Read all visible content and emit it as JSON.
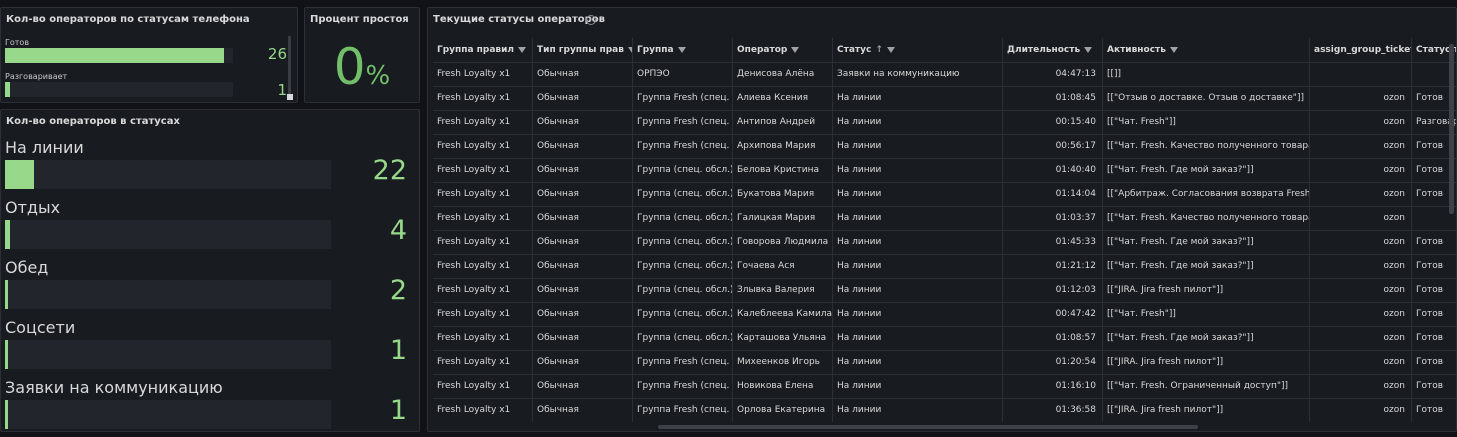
{
  "phone_panel": {
    "title": "Кол-во операторов по статусам телефона",
    "items": [
      {
        "label": "Готов",
        "value": "26",
        "fraction": 0.96
      },
      {
        "label": "Разговаривает",
        "value": "1",
        "fraction": 0.02
      }
    ]
  },
  "idle_panel": {
    "title": "Процент простоя",
    "value": "0",
    "unit": "%"
  },
  "status_panel": {
    "title": "Кол-во операторов в статусах",
    "items": [
      {
        "label": "На линии",
        "value": "22",
        "fraction": 0.088
      },
      {
        "label": "Отдых",
        "value": "4",
        "fraction": 0.016
      },
      {
        "label": "Обед",
        "value": "2",
        "fraction": 0.008
      },
      {
        "label": "Соцсети",
        "value": "1",
        "fraction": 0.004
      },
      {
        "label": "Заявки на коммуникацию",
        "value": "1",
        "fraction": 0.004
      }
    ]
  },
  "table_panel": {
    "title": "Текущие статусы операторов",
    "info_icon": "i",
    "columns": [
      "Группа правил",
      "Тип группы прав",
      "Группа",
      "Оператор",
      "Статус",
      "Длительность",
      "Активность",
      "assign_group_ticket",
      "Статус телефона"
    ],
    "sort_indicator": "↑",
    "rows": [
      [
        "Fresh Loyalty x1",
        "Обычная",
        "ОРПЭО",
        "Денисова Алёна",
        "Заявки на коммуникацию",
        "04:47:13",
        "[[]]",
        "",
        ""
      ],
      [
        "Fresh Loyalty x1",
        "Обычная",
        "Группа Fresh (спец. обсл.)",
        "Алиева Ксения",
        "На линии",
        "01:08:45",
        "[[\"Отзыв о доставке. Отзыв о доставке\"]]",
        "ozon",
        "Готов"
      ],
      [
        "Fresh Loyalty x1",
        "Обычная",
        "Группа Fresh (спец. обсл.)",
        "Антипов Андрей",
        "На линии",
        "00:15:40",
        "[[\"Чат. Fresh\"]]",
        "ozon",
        "Разговаривает"
      ],
      [
        "Fresh Loyalty x1",
        "Обычная",
        "Группа Fresh (спец. обсл.)",
        "Архипова Мария",
        "На линии",
        "00:56:17",
        "[[\"Чат. Fresh. Качество полученного товара\"]]",
        "ozon",
        "Готов"
      ],
      [
        "Fresh Loyalty x1",
        "Обычная",
        "Группа (спец. обсл.)",
        "Белова Кристина",
        "На линии",
        "01:40:40",
        "[[\"Чат. Fresh. Где мой заказ?\"]]",
        "ozon",
        "Готов"
      ],
      [
        "Fresh Loyalty x1",
        "Обычная",
        "Группа (спец. обсл.)",
        "Букатова Мария",
        "На линии",
        "01:14:04",
        "[[\"Арбитраж. Согласования возврата Fresh\"]]",
        "ozon",
        "Готов"
      ],
      [
        "Fresh Loyalty x1",
        "Обычная",
        "Группа (спец. обсл.)",
        "Галицкая Мария",
        "На линии",
        "01:03:37",
        "[[\"Чат. Fresh. Качество полученного товара\"]]",
        "ozon",
        ""
      ],
      [
        "Fresh Loyalty x1",
        "Обычная",
        "Группа (спец. обсл.)",
        "Говорова Людмила",
        "На линии",
        "01:45:33",
        "[[\"Чат. Fresh. Где мой заказ?\"]]",
        "ozon",
        "Готов"
      ],
      [
        "Fresh Loyalty x1",
        "Обычная",
        "Группа (спец. обсл.)",
        "Гочаева Ася",
        "На линии",
        "01:21:12",
        "[[\"Чат. Fresh. Где мой заказ?\"]]",
        "ozon",
        "Готов"
      ],
      [
        "Fresh Loyalty x1",
        "Обычная",
        "Группа (спец. обсл.)",
        "Злывка Валерия",
        "На линии",
        "01:12:03",
        "[[\"JIRA. Jira fresh пилот\"]]",
        "ozon",
        "Готов"
      ],
      [
        "Fresh Loyalty x1",
        "Обычная",
        "Группа (спец. обсл.)",
        "Калеблеева Камила",
        "На линии",
        "00:47:42",
        "[[\"Чат. Fresh\"]]",
        "ozon",
        "Готов"
      ],
      [
        "Fresh Loyalty x1",
        "Обычная",
        "Группа (спец. обсл.)",
        "Карташова Ульяна",
        "На линии",
        "01:08:57",
        "[[\"Чат. Fresh. Где мой заказ?\"]]",
        "ozon",
        "Готов"
      ],
      [
        "Fresh Loyalty x1",
        "Обычная",
        "Группа Fresh (спец. обсл.)",
        "Михеенков Игорь",
        "На линии",
        "01:20:54",
        "[[\"JIRA. Jira fresh пилот\"]]",
        "ozon",
        "Готов"
      ],
      [
        "Fresh Loyalty x1",
        "Обычная",
        "Группа Fresh (спец. обсл.)",
        "Новикова Елена",
        "На линии",
        "01:16:10",
        "[[\"Чат. Fresh. Ограниченный доступ\"]]",
        "ozon",
        "Готов"
      ],
      [
        "Fresh Loyalty x1",
        "Обычная",
        "Группа Fresh (спец. обсл.)",
        "Орлова Екатерина",
        "На линии",
        "01:36:58",
        "[[\"JIRA. Jira fresh пилот\"]]",
        "ozon",
        "Готов"
      ]
    ]
  },
  "colors": {
    "bar": "#97d88a",
    "value": "#97d88a",
    "percent": "#73bf69",
    "panel_bg": "#181b1f",
    "page_bg": "#111217"
  }
}
